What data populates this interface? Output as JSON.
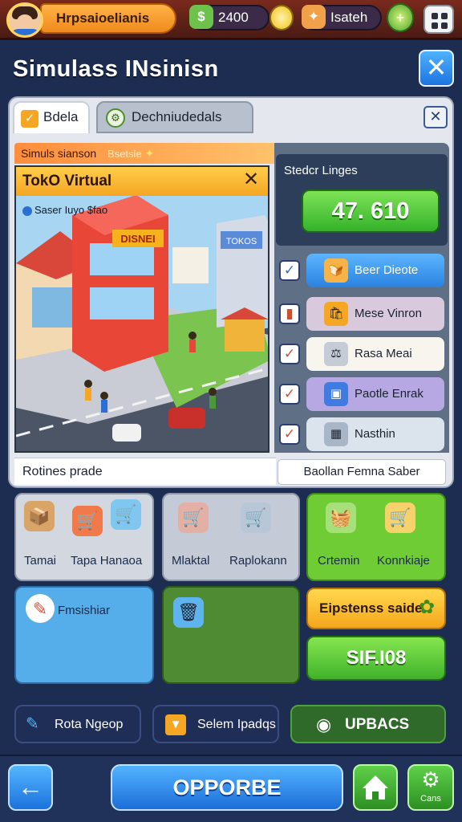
{
  "topbar": {
    "player_name": "Hrpsaioelianis",
    "resource_1_value": "2400",
    "resource_2_value": "Isateh"
  },
  "header": {
    "title": "Simulass INsinisn"
  },
  "tabs": [
    {
      "label": "Bdela",
      "active": true
    },
    {
      "label": "Dechniudedals",
      "active": false
    }
  ],
  "game": {
    "banner": "Simuls sianson",
    "banner_sub": "Bsetsle",
    "window_title": "TokO Virtual",
    "caption": "Saser Iuyo $fao",
    "shop_sign": "DISNEI",
    "ticket_sign": "TOKOS"
  },
  "stats": {
    "label": "Stedcr Linges",
    "value": "47. 610"
  },
  "list": [
    {
      "label": "Beer Dieote",
      "checked": true,
      "color": "#3f9ef0",
      "icon": "bread-icon",
      "glyph": "🍞"
    },
    {
      "label": "Mese Vinron",
      "checked": true,
      "color": "#d9c9dd",
      "icon": "bag-icon",
      "glyph": "🛍"
    },
    {
      "label": "Rasa Meai",
      "checked": true,
      "color": "#f7f5ee",
      "icon": "scale-icon",
      "glyph": "⚖"
    },
    {
      "label": "Paotle Enrak",
      "checked": true,
      "color": "#b7a7e2",
      "icon": "box-icon",
      "glyph": "📦"
    },
    {
      "label": "Nasthin",
      "checked": true,
      "color": "#dbe3ec",
      "icon": "pack-icon",
      "glyph": "🗃"
    }
  ],
  "routines_label": "Rotines prade",
  "field_value": "Baollan Femna Saber",
  "cards": {
    "card1_left": "Tamai",
    "card1_right": "Tapa Hanaoa",
    "card2_left": "Mlaktal",
    "card2_right": "Raplokann",
    "card3_left": "Crtemin",
    "card3_right": "Konnkiaje",
    "card4_label": "Fmsishiar"
  },
  "buttons": {
    "yellow": "Eipstenss saide",
    "green": "SIF.I08"
  },
  "nav": {
    "nav1": "Rota Ngeop",
    "nav2": "Selem Ipadqs",
    "nav3": "UPBACS"
  },
  "footer": {
    "main_action": "OPPORBE",
    "gear_label": "Cans"
  },
  "colors": {
    "accent_blue": "#1c6ed8",
    "accent_green": "#3fb22a",
    "accent_orange": "#f08a1d"
  }
}
